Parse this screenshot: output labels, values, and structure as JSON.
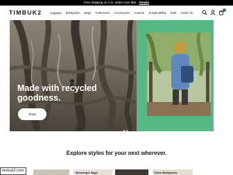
{
  "promo": {
    "text": "Free Shipping on U.S. orders over $95.",
    "link": "Details"
  },
  "header": {
    "logo": "TIMBUK2",
    "nav": [
      "Luggage",
      "Backpacks",
      "Bags",
      "Collections",
      "Accessories",
      "Custom",
      "Sustainability",
      "Sale",
      "Inside T2"
    ],
    "cart_count": "0",
    "icons": [
      "search-icon",
      "account-icon",
      "cart-icon"
    ]
  },
  "hero": {
    "title_line1": "Made with recycled",
    "title_line2": "goodness.",
    "button": "Shop"
  },
  "section": {
    "title": "Explore styles for your next wherever."
  },
  "thumbs": {
    "label1": "Messenger Bags",
    "label2": "Travel Backpacks"
  },
  "alt_tag": "timbuk2.com",
  "colors": {
    "accent": "#1a6b53",
    "promo_bg": "#000000",
    "hero_right_bg": "#55b885"
  }
}
